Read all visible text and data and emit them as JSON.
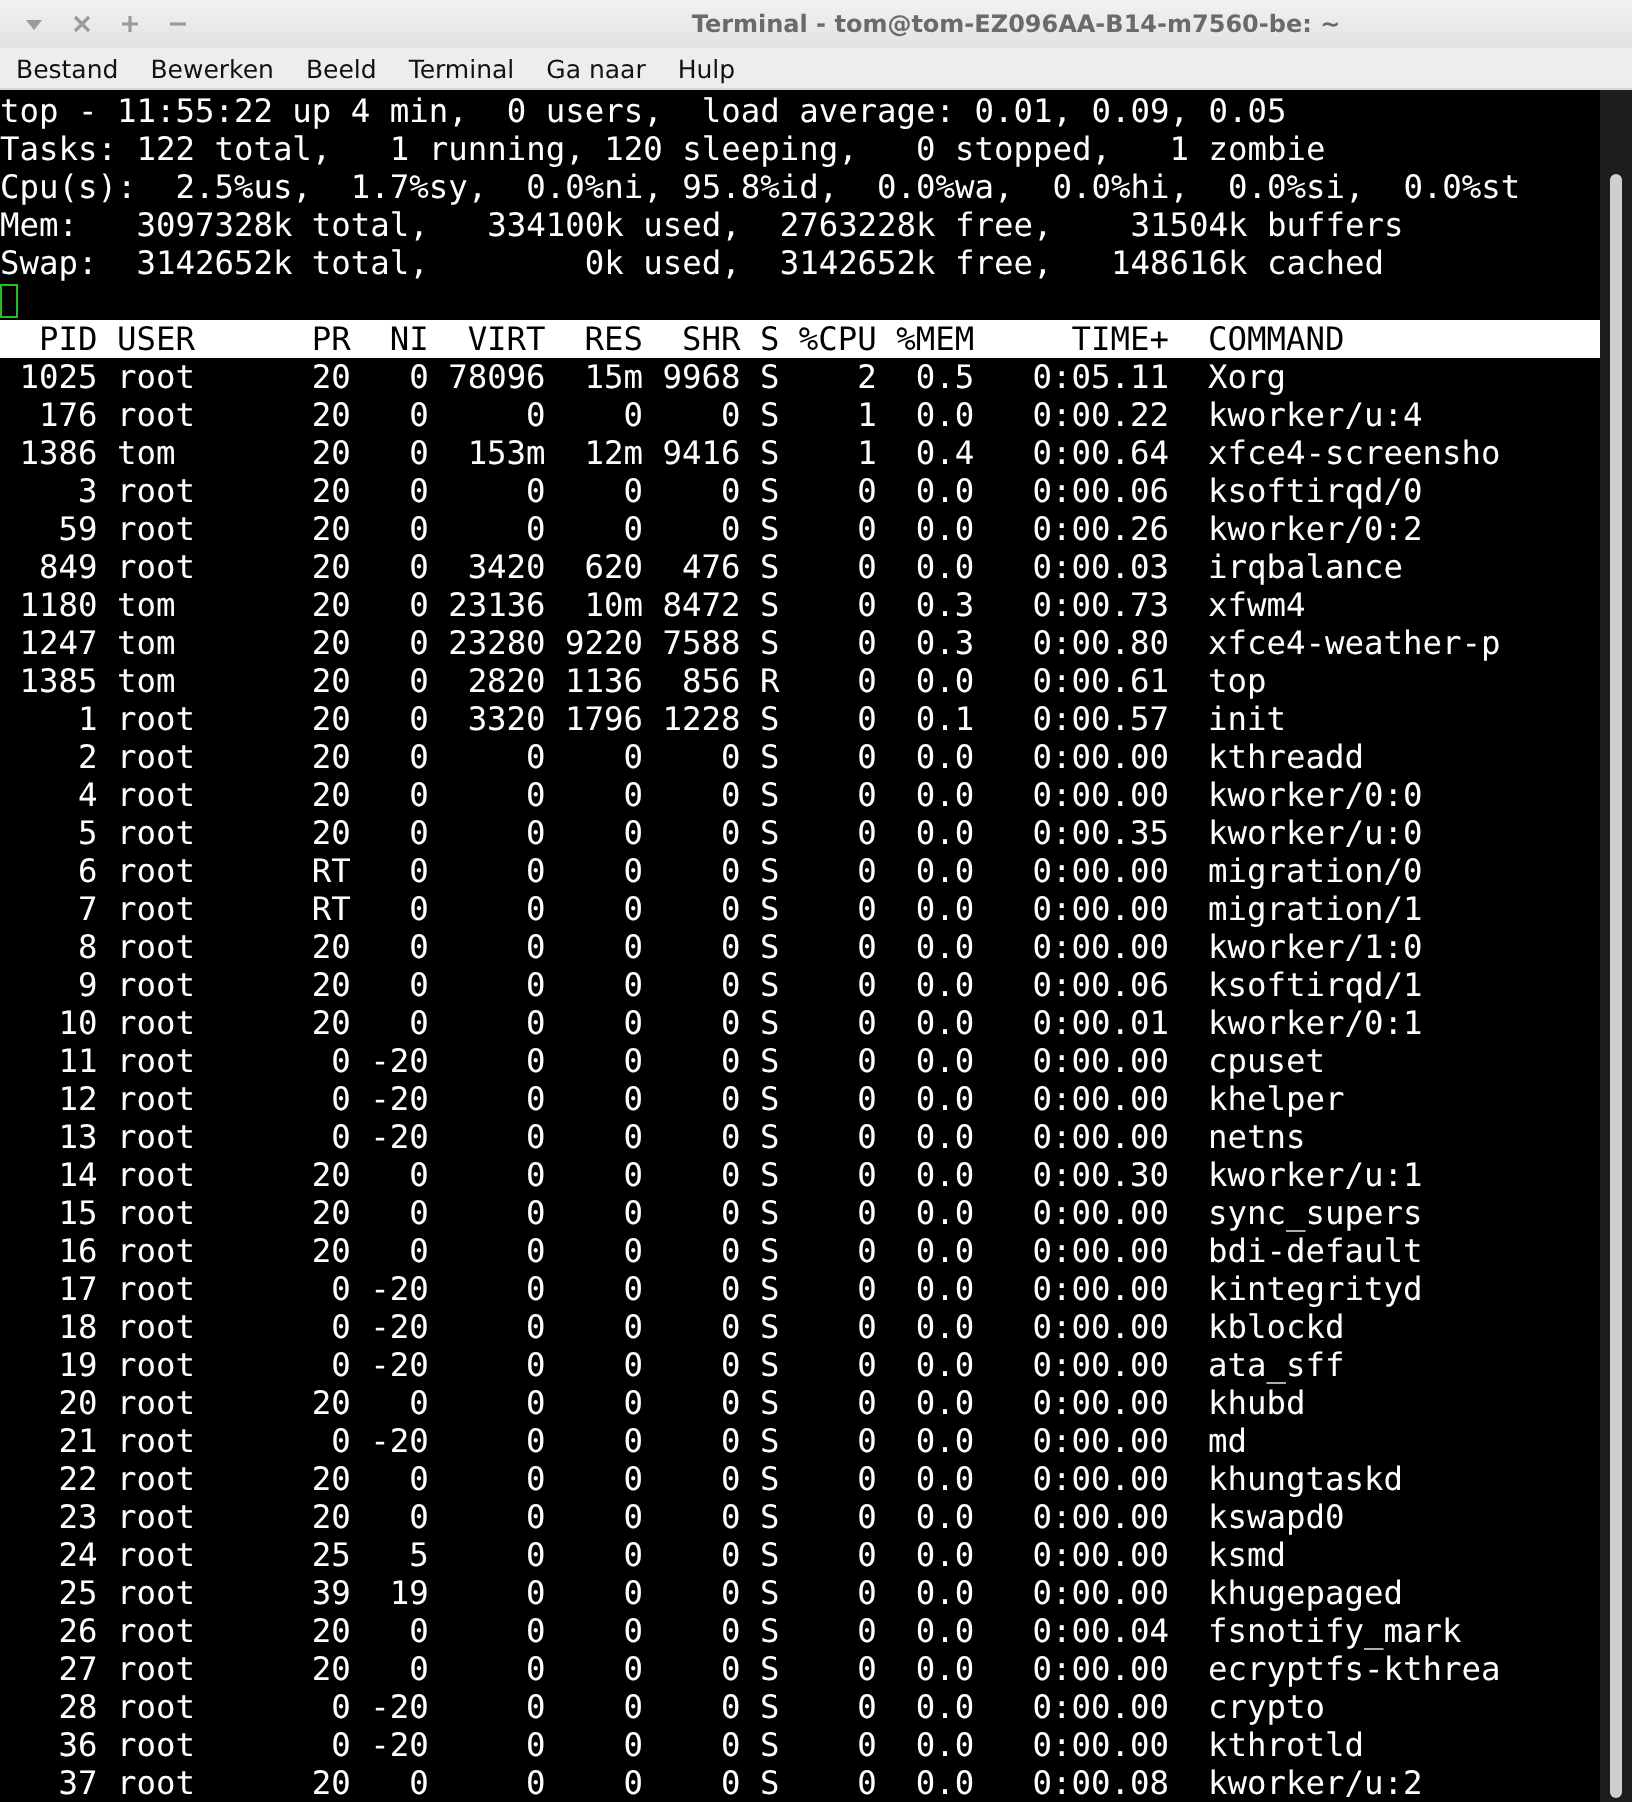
{
  "window": {
    "title": "Terminal - tom@tom-EZ096AA-B14-m7560-be: ~"
  },
  "menu": [
    "Bestand",
    "Bewerken",
    "Beeld",
    "Terminal",
    "Ga naar",
    "Hulp"
  ],
  "summary": [
    "top - 11:55:22 up 4 min,  0 users,  load average: 0.01, 0.09, 0.05",
    "Tasks: 122 total,   1 running, 120 sleeping,   0 stopped,   1 zombie",
    "Cpu(s):  2.5%us,  1.7%sy,  0.0%ni, 95.8%id,  0.0%wa,  0.0%hi,  0.0%si,  0.0%st",
    "Mem:   3097328k total,   334100k used,  2763228k free,    31504k buffers",
    "Swap:  3142652k total,        0k used,  3142652k free,   148616k cached"
  ],
  "columns": [
    "PID",
    "USER",
    "PR",
    "NI",
    "VIRT",
    "RES",
    "SHR",
    "S",
    "%CPU",
    "%MEM",
    "TIME+",
    "COMMAND"
  ],
  "rows": [
    [
      "1025",
      "root",
      "20",
      "0",
      "78096",
      "15m",
      "9968",
      "S",
      "2",
      "0.5",
      "0:05.11",
      "Xorg"
    ],
    [
      "176",
      "root",
      "20",
      "0",
      "0",
      "0",
      "0",
      "S",
      "1",
      "0.0",
      "0:00.22",
      "kworker/u:4"
    ],
    [
      "1386",
      "tom",
      "20",
      "0",
      "153m",
      "12m",
      "9416",
      "S",
      "1",
      "0.4",
      "0:00.64",
      "xfce4-screensho"
    ],
    [
      "3",
      "root",
      "20",
      "0",
      "0",
      "0",
      "0",
      "S",
      "0",
      "0.0",
      "0:00.06",
      "ksoftirqd/0"
    ],
    [
      "59",
      "root",
      "20",
      "0",
      "0",
      "0",
      "0",
      "S",
      "0",
      "0.0",
      "0:00.26",
      "kworker/0:2"
    ],
    [
      "849",
      "root",
      "20",
      "0",
      "3420",
      "620",
      "476",
      "S",
      "0",
      "0.0",
      "0:00.03",
      "irqbalance"
    ],
    [
      "1180",
      "tom",
      "20",
      "0",
      "23136",
      "10m",
      "8472",
      "S",
      "0",
      "0.3",
      "0:00.73",
      "xfwm4"
    ],
    [
      "1247",
      "tom",
      "20",
      "0",
      "23280",
      "9220",
      "7588",
      "S",
      "0",
      "0.3",
      "0:00.80",
      "xfce4-weather-p"
    ],
    [
      "1385",
      "tom",
      "20",
      "0",
      "2820",
      "1136",
      "856",
      "R",
      "0",
      "0.0",
      "0:00.61",
      "top"
    ],
    [
      "1",
      "root",
      "20",
      "0",
      "3320",
      "1796",
      "1228",
      "S",
      "0",
      "0.1",
      "0:00.57",
      "init"
    ],
    [
      "2",
      "root",
      "20",
      "0",
      "0",
      "0",
      "0",
      "S",
      "0",
      "0.0",
      "0:00.00",
      "kthreadd"
    ],
    [
      "4",
      "root",
      "20",
      "0",
      "0",
      "0",
      "0",
      "S",
      "0",
      "0.0",
      "0:00.00",
      "kworker/0:0"
    ],
    [
      "5",
      "root",
      "20",
      "0",
      "0",
      "0",
      "0",
      "S",
      "0",
      "0.0",
      "0:00.35",
      "kworker/u:0"
    ],
    [
      "6",
      "root",
      "RT",
      "0",
      "0",
      "0",
      "0",
      "S",
      "0",
      "0.0",
      "0:00.00",
      "migration/0"
    ],
    [
      "7",
      "root",
      "RT",
      "0",
      "0",
      "0",
      "0",
      "S",
      "0",
      "0.0",
      "0:00.00",
      "migration/1"
    ],
    [
      "8",
      "root",
      "20",
      "0",
      "0",
      "0",
      "0",
      "S",
      "0",
      "0.0",
      "0:00.00",
      "kworker/1:0"
    ],
    [
      "9",
      "root",
      "20",
      "0",
      "0",
      "0",
      "0",
      "S",
      "0",
      "0.0",
      "0:00.06",
      "ksoftirqd/1"
    ],
    [
      "10",
      "root",
      "20",
      "0",
      "0",
      "0",
      "0",
      "S",
      "0",
      "0.0",
      "0:00.01",
      "kworker/0:1"
    ],
    [
      "11",
      "root",
      "0",
      "-20",
      "0",
      "0",
      "0",
      "S",
      "0",
      "0.0",
      "0:00.00",
      "cpuset"
    ],
    [
      "12",
      "root",
      "0",
      "-20",
      "0",
      "0",
      "0",
      "S",
      "0",
      "0.0",
      "0:00.00",
      "khelper"
    ],
    [
      "13",
      "root",
      "0",
      "-20",
      "0",
      "0",
      "0",
      "S",
      "0",
      "0.0",
      "0:00.00",
      "netns"
    ],
    [
      "14",
      "root",
      "20",
      "0",
      "0",
      "0",
      "0",
      "S",
      "0",
      "0.0",
      "0:00.30",
      "kworker/u:1"
    ],
    [
      "15",
      "root",
      "20",
      "0",
      "0",
      "0",
      "0",
      "S",
      "0",
      "0.0",
      "0:00.00",
      "sync_supers"
    ],
    [
      "16",
      "root",
      "20",
      "0",
      "0",
      "0",
      "0",
      "S",
      "0",
      "0.0",
      "0:00.00",
      "bdi-default"
    ],
    [
      "17",
      "root",
      "0",
      "-20",
      "0",
      "0",
      "0",
      "S",
      "0",
      "0.0",
      "0:00.00",
      "kintegrityd"
    ],
    [
      "18",
      "root",
      "0",
      "-20",
      "0",
      "0",
      "0",
      "S",
      "0",
      "0.0",
      "0:00.00",
      "kblockd"
    ],
    [
      "19",
      "root",
      "0",
      "-20",
      "0",
      "0",
      "0",
      "S",
      "0",
      "0.0",
      "0:00.00",
      "ata_sff"
    ],
    [
      "20",
      "root",
      "20",
      "0",
      "0",
      "0",
      "0",
      "S",
      "0",
      "0.0",
      "0:00.00",
      "khubd"
    ],
    [
      "21",
      "root",
      "0",
      "-20",
      "0",
      "0",
      "0",
      "S",
      "0",
      "0.0",
      "0:00.00",
      "md"
    ],
    [
      "22",
      "root",
      "20",
      "0",
      "0",
      "0",
      "0",
      "S",
      "0",
      "0.0",
      "0:00.00",
      "khungtaskd"
    ],
    [
      "23",
      "root",
      "20",
      "0",
      "0",
      "0",
      "0",
      "S",
      "0",
      "0.0",
      "0:00.00",
      "kswapd0"
    ],
    [
      "24",
      "root",
      "25",
      "5",
      "0",
      "0",
      "0",
      "S",
      "0",
      "0.0",
      "0:00.00",
      "ksmd"
    ],
    [
      "25",
      "root",
      "39",
      "19",
      "0",
      "0",
      "0",
      "S",
      "0",
      "0.0",
      "0:00.00",
      "khugepaged"
    ],
    [
      "26",
      "root",
      "20",
      "0",
      "0",
      "0",
      "0",
      "S",
      "0",
      "0.0",
      "0:00.04",
      "fsnotify_mark"
    ],
    [
      "27",
      "root",
      "20",
      "0",
      "0",
      "0",
      "0",
      "S",
      "0",
      "0.0",
      "0:00.00",
      "ecryptfs-kthrea"
    ],
    [
      "28",
      "root",
      "0",
      "-20",
      "0",
      "0",
      "0",
      "S",
      "0",
      "0.0",
      "0:00.00",
      "crypto"
    ],
    [
      "36",
      "root",
      "0",
      "-20",
      "0",
      "0",
      "0",
      "S",
      "0",
      "0.0",
      "0:00.00",
      "kthrotld"
    ],
    [
      "37",
      "root",
      "20",
      "0",
      "0",
      "0",
      "0",
      "S",
      "0",
      "0.0",
      "0:00.08",
      "kworker/u:2"
    ]
  ]
}
